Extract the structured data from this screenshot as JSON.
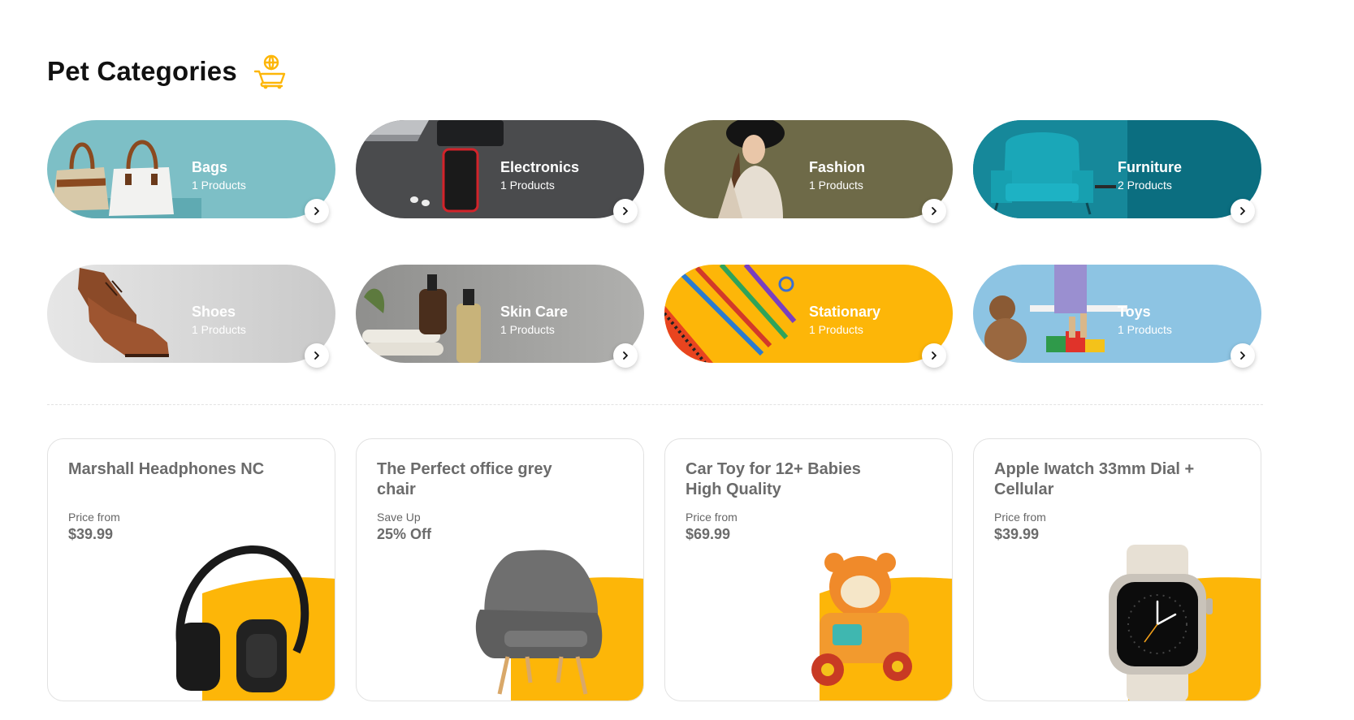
{
  "section": {
    "title": "Pet Categories",
    "icon": "shopping-cart-icon",
    "accent": "#FDB608"
  },
  "categories": [
    {
      "name": "Bags",
      "count": "1 Products",
      "bg": "#7DBFC6"
    },
    {
      "name": "Electronics",
      "count": "1 Products",
      "bg": "#4A4B4D"
    },
    {
      "name": "Fashion",
      "count": "1 Products",
      "bg": "#6E6A48"
    },
    {
      "name": "Furniture",
      "count": "2 Products",
      "bg": "#0B6E80"
    },
    {
      "name": "Shoes",
      "count": "1 Products",
      "bg": "#D4D4D4"
    },
    {
      "name": "Skin Care",
      "count": "1 Products",
      "bg": "#9A9A98"
    },
    {
      "name": "Stationary",
      "count": "1 Products",
      "bg": "#FDB608"
    },
    {
      "name": "Toys",
      "count": "1 Products",
      "bg": "#8DC4E3"
    }
  ],
  "products": [
    {
      "title": "Marshall Headphones NC",
      "price_label": "Price from",
      "price": "$39.99"
    },
    {
      "title": "The Perfect office grey chair",
      "price_label": "Save Up",
      "price": "25% Off"
    },
    {
      "title": "Car Toy for 12+ Babies High Quality",
      "price_label": "Price from",
      "price": "$69.99"
    },
    {
      "title": "Apple Iwatch 33mm Dial + Cellular",
      "price_label": "Price from",
      "price": "$39.99"
    }
  ]
}
